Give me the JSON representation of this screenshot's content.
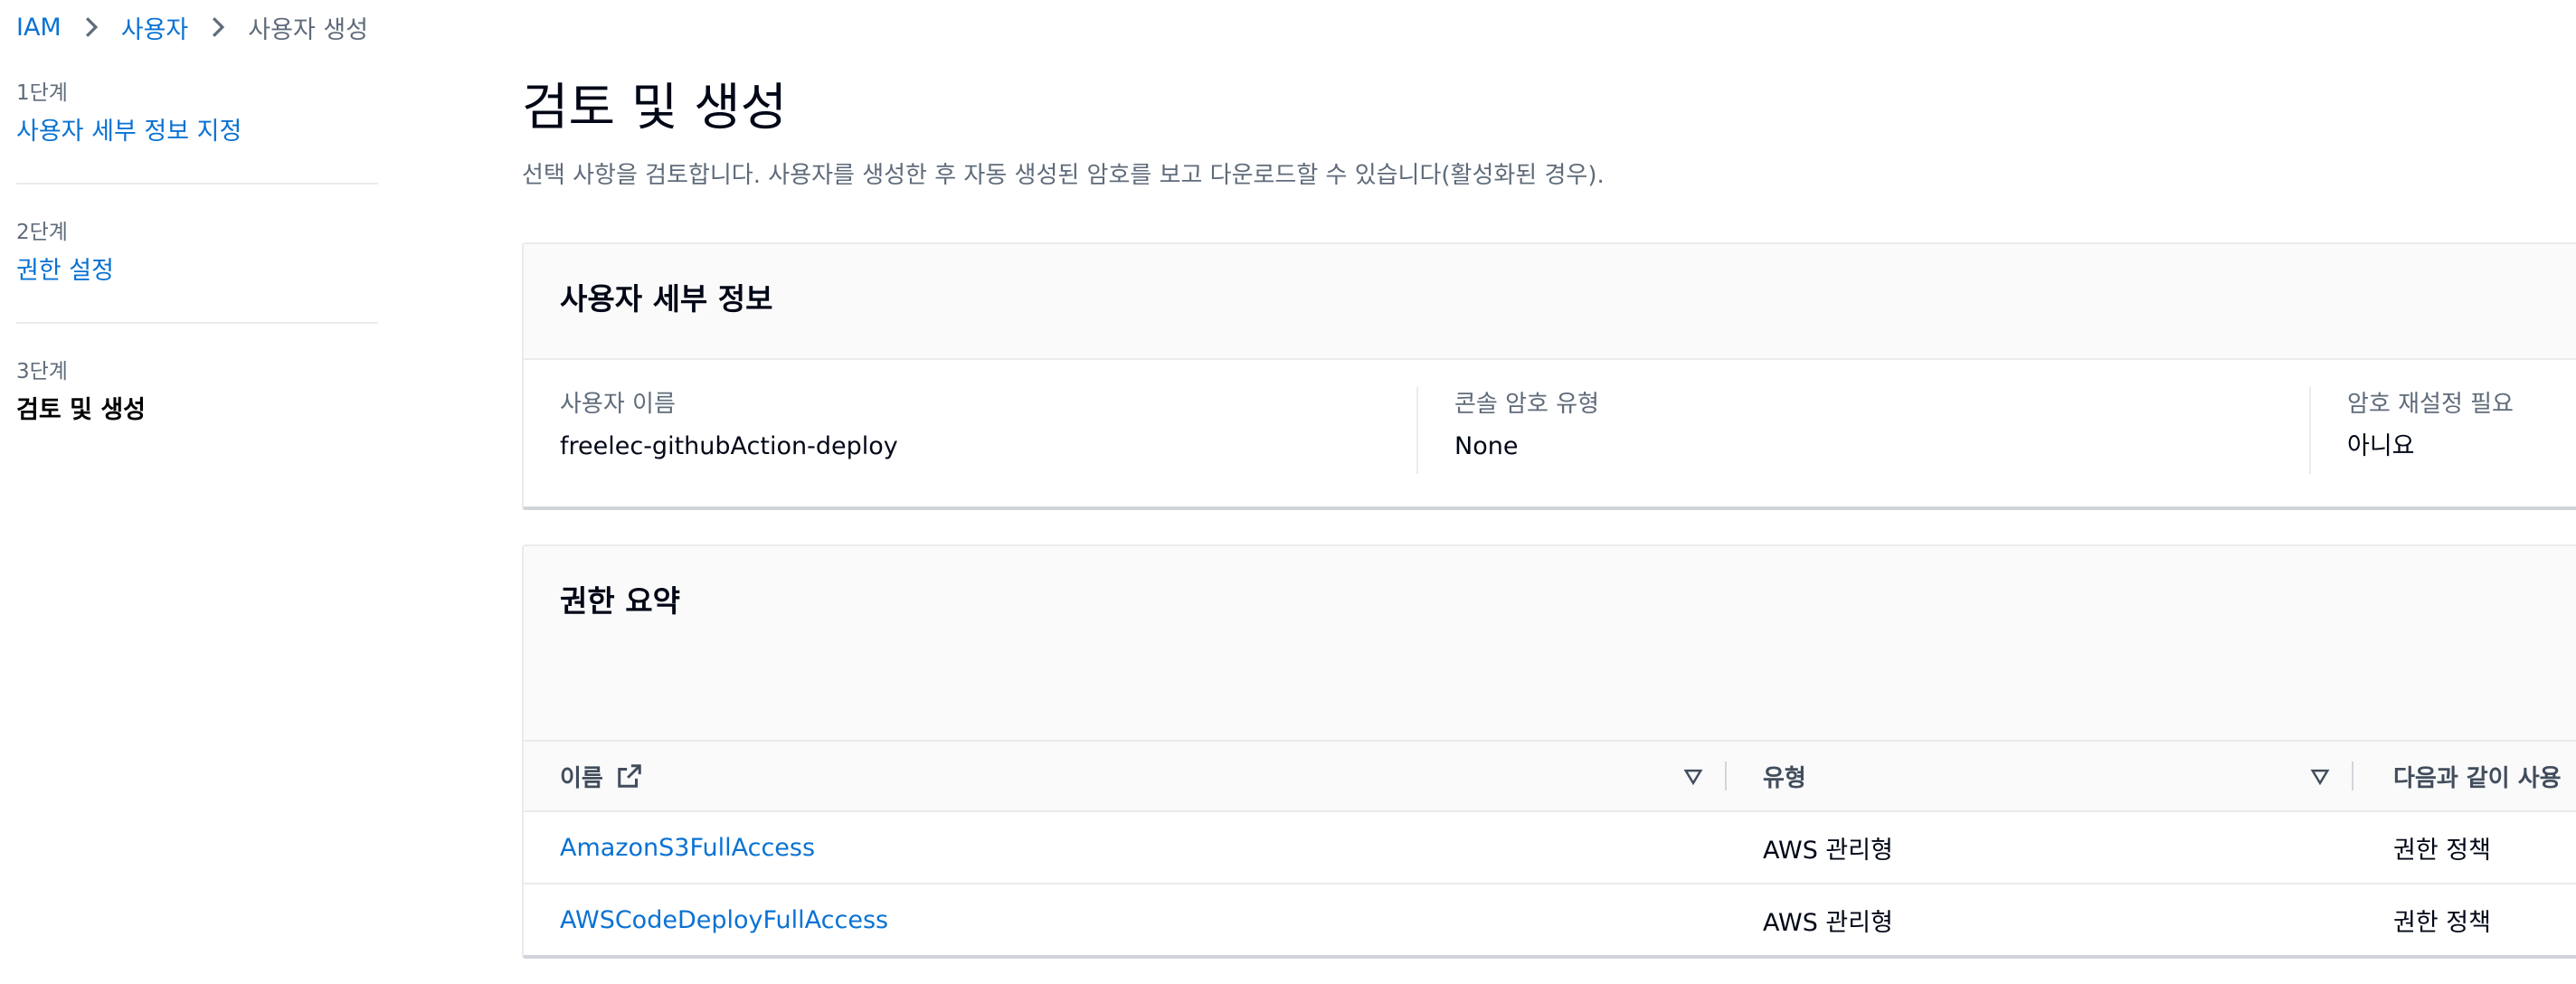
{
  "breadcrumb": {
    "items": [
      "IAM",
      "사용자",
      "사용자 생성"
    ]
  },
  "wizard": {
    "steps": [
      {
        "number": "1단계",
        "title": "사용자 세부 정보 지정"
      },
      {
        "number": "2단계",
        "title": "권한 설정"
      },
      {
        "number": "3단계",
        "title": "검토 및 생성"
      }
    ]
  },
  "main": {
    "title": "검토 및 생성",
    "description": "선택 사항을 검토합니다. 사용자를 생성한 후 자동 생성된 암호를 보고 다운로드할 수 있습니다(활성화된 경우)."
  },
  "user_details": {
    "title": "사용자 세부 정보",
    "fields": [
      {
        "label": "사용자 이름",
        "value": "freelec-githubAction-deploy"
      },
      {
        "label": "콘솔 암호 유형",
        "value": "None"
      },
      {
        "label": "암호 재설정 필요",
        "value": "아니요"
      }
    ]
  },
  "permissions": {
    "title": "권한 요약",
    "columns": {
      "name": "이름",
      "type": "유형",
      "usage": "다음과 같이 사용"
    },
    "rows": [
      {
        "name": "AmazonS3FullAccess",
        "type": "AWS 관리형",
        "usage": "권한 정책"
      },
      {
        "name": "AWSCodeDeployFullAccess",
        "type": "AWS 관리형",
        "usage": "권한 정책"
      }
    ]
  },
  "colors": {
    "link": "#0972d3",
    "muted_text": "#5f6b7a",
    "border": "#e9ebed",
    "header_bg": "#fafafa"
  }
}
